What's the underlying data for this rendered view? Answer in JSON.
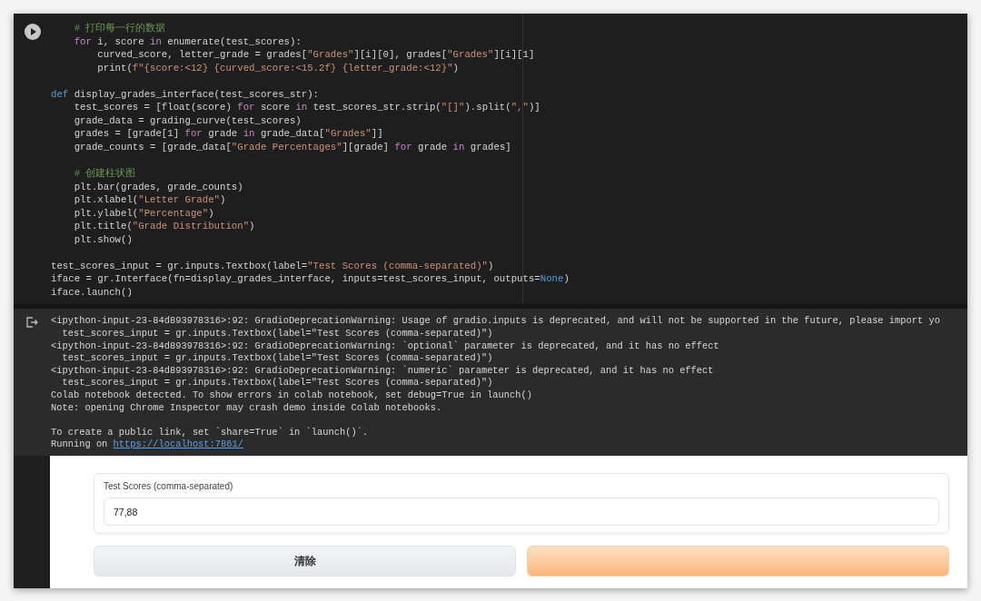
{
  "code_cell": {
    "lines": [
      {
        "kind": "code",
        "tokens": [
          {
            "text": "    # 打印每一行的数据",
            "kind": "comment"
          }
        ]
      },
      {
        "kind": "code",
        "tokens": [
          {
            "text": "    for",
            "kind": "kw"
          },
          {
            "text": " i, score ",
            "kind": "plain"
          },
          {
            "text": "in",
            "kind": "kw"
          },
          {
            "text": " enumerate(test_scores):",
            "kind": "plain"
          }
        ]
      },
      {
        "kind": "code",
        "tokens": [
          {
            "text": "        curved_score, letter_grade = grades[",
            "kind": "plain"
          },
          {
            "text": "\"Grades\"",
            "kind": "str"
          },
          {
            "text": "][i][0], grades[",
            "kind": "plain"
          },
          {
            "text": "\"Grades\"",
            "kind": "str"
          },
          {
            "text": "][i][1]",
            "kind": "plain"
          }
        ]
      },
      {
        "kind": "code",
        "tokens": [
          {
            "text": "        print(",
            "kind": "plain"
          },
          {
            "text": "f\"{score:<12} {curved_score:<15.2f} {letter_grade:<12}\"",
            "kind": "str"
          },
          {
            "text": ")",
            "kind": "plain"
          }
        ]
      },
      {
        "kind": "blank"
      },
      {
        "kind": "code",
        "tokens": [
          {
            "text": "def",
            "kind": "def"
          },
          {
            "text": " display_grades_interface(test_scores_str):",
            "kind": "plain"
          }
        ]
      },
      {
        "kind": "code",
        "tokens": [
          {
            "text": "    test_scores = [float(score) ",
            "kind": "plain"
          },
          {
            "text": "for",
            "kind": "kw"
          },
          {
            "text": " score ",
            "kind": "plain"
          },
          {
            "text": "in",
            "kind": "kw"
          },
          {
            "text": " test_scores_str.strip(",
            "kind": "plain"
          },
          {
            "text": "\"[]\"",
            "kind": "str"
          },
          {
            "text": ").split(",
            "kind": "plain"
          },
          {
            "text": "\",\"",
            "kind": "str"
          },
          {
            "text": ")]",
            "kind": "plain"
          }
        ]
      },
      {
        "kind": "code",
        "tokens": [
          {
            "text": "    grade_data = grading_curve(test_scores)",
            "kind": "plain"
          }
        ]
      },
      {
        "kind": "code",
        "tokens": [
          {
            "text": "    grades = [grade[1] ",
            "kind": "plain"
          },
          {
            "text": "for",
            "kind": "kw"
          },
          {
            "text": " grade ",
            "kind": "plain"
          },
          {
            "text": "in",
            "kind": "kw"
          },
          {
            "text": " grade_data[",
            "kind": "plain"
          },
          {
            "text": "\"Grades\"",
            "kind": "str"
          },
          {
            "text": "]]",
            "kind": "plain"
          }
        ]
      },
      {
        "kind": "code",
        "tokens": [
          {
            "text": "    grade_counts = [grade_data[",
            "kind": "plain"
          },
          {
            "text": "\"Grade Percentages\"",
            "kind": "str"
          },
          {
            "text": "][grade] ",
            "kind": "plain"
          },
          {
            "text": "for",
            "kind": "kw"
          },
          {
            "text": " grade ",
            "kind": "plain"
          },
          {
            "text": "in",
            "kind": "kw"
          },
          {
            "text": " grades]",
            "kind": "plain"
          }
        ]
      },
      {
        "kind": "blank"
      },
      {
        "kind": "code",
        "tokens": [
          {
            "text": "    # 创建柱状图",
            "kind": "comment"
          }
        ]
      },
      {
        "kind": "code",
        "tokens": [
          {
            "text": "    plt.bar(grades, grade_counts)",
            "kind": "plain"
          }
        ]
      },
      {
        "kind": "code",
        "tokens": [
          {
            "text": "    plt.xlabel(",
            "kind": "plain"
          },
          {
            "text": "\"Letter Grade\"",
            "kind": "str"
          },
          {
            "text": ")",
            "kind": "plain"
          }
        ]
      },
      {
        "kind": "code",
        "tokens": [
          {
            "text": "    plt.ylabel(",
            "kind": "plain"
          },
          {
            "text": "\"Percentage\"",
            "kind": "str"
          },
          {
            "text": ")",
            "kind": "plain"
          }
        ]
      },
      {
        "kind": "code",
        "tokens": [
          {
            "text": "    plt.title(",
            "kind": "plain"
          },
          {
            "text": "\"Grade Distribution\"",
            "kind": "str"
          },
          {
            "text": ")",
            "kind": "plain"
          }
        ]
      },
      {
        "kind": "code",
        "tokens": [
          {
            "text": "    plt.show()",
            "kind": "plain"
          }
        ]
      },
      {
        "kind": "blank"
      },
      {
        "kind": "code",
        "tokens": [
          {
            "text": "test_scores_input = gr.inputs.Textbox(label=",
            "kind": "plain"
          },
          {
            "text": "\"Test Scores (comma-separated)\"",
            "kind": "str"
          },
          {
            "text": ")",
            "kind": "plain"
          }
        ]
      },
      {
        "kind": "code",
        "tokens": [
          {
            "text": "iface = gr.Interface(fn=display_grades_interface, inputs=test_scores_input, outputs=",
            "kind": "plain"
          },
          {
            "text": "None",
            "kind": "const"
          },
          {
            "text": ")",
            "kind": "plain"
          }
        ]
      },
      {
        "kind": "code",
        "tokens": [
          {
            "text": "iface.launch()",
            "kind": "plain"
          }
        ]
      }
    ]
  },
  "output": {
    "lines": [
      {
        "kind": "text",
        "text": "<ipython-input-23-84d893978316>:92: GradioDeprecationWarning: Usage of gradio.inputs is deprecated, and will not be supported in the future, please import yo"
      },
      {
        "kind": "text",
        "text": "  test_scores_input = gr.inputs.Textbox(label=\"Test Scores (comma-separated)\")"
      },
      {
        "kind": "text",
        "text": "<ipython-input-23-84d893978316>:92: GradioDeprecationWarning: `optional` parameter is deprecated, and it has no effect"
      },
      {
        "kind": "text",
        "text": "  test_scores_input = gr.inputs.Textbox(label=\"Test Scores (comma-separated)\")"
      },
      {
        "kind": "text",
        "text": "<ipython-input-23-84d893978316>:92: GradioDeprecationWarning: `numeric` parameter is deprecated, and it has no effect"
      },
      {
        "kind": "text",
        "text": "  test_scores_input = gr.inputs.Textbox(label=\"Test Scores (comma-separated)\")"
      },
      {
        "kind": "text",
        "text": "Colab notebook detected. To show errors in colab notebook, set debug=True in launch()"
      },
      {
        "kind": "text",
        "text": "Note: opening Chrome Inspector may crash demo inside Colab notebooks."
      },
      {
        "kind": "blank"
      },
      {
        "kind": "text",
        "text": "To create a public link, set `share=True` in `launch()`."
      },
      {
        "kind": "link",
        "text": "Running on ",
        "link": "https://localhost:7861/"
      }
    ]
  },
  "app": {
    "field": {
      "label": "Test Scores (comma-separated)",
      "value": "77,88"
    },
    "buttons": [
      {
        "kind": "secondary",
        "label": "清除"
      },
      {
        "kind": "primary"
      }
    ]
  }
}
